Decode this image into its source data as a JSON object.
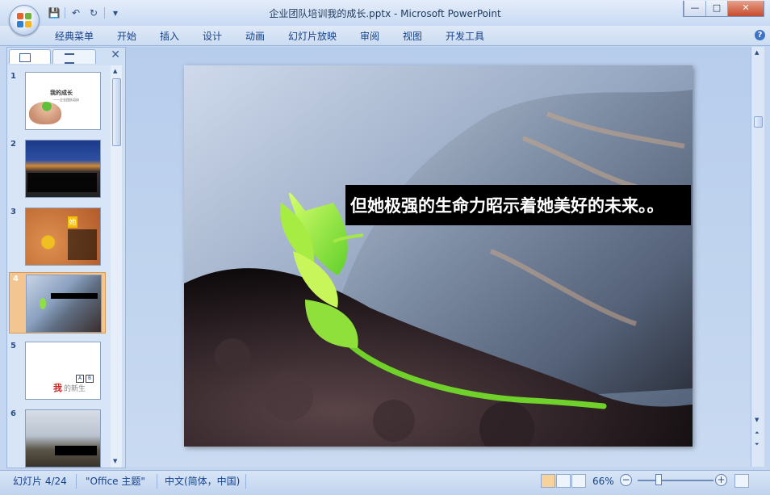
{
  "window": {
    "title": "企业团队培训我的成长.pptx - Microsoft PowerPoint",
    "controls": {
      "minimize": "—",
      "maximize": "□",
      "close": "✕"
    }
  },
  "qat": {
    "save": "💾",
    "undo": "↶",
    "redo": "↻",
    "more": "▾"
  },
  "menu": [
    "经典菜单",
    "开始",
    "插入",
    "设计",
    "动画",
    "幻灯片放映",
    "审阅",
    "视图",
    "开发工具"
  ],
  "help": "?",
  "panel": {
    "close": "✕"
  },
  "thumbnails": [
    {
      "num": "1",
      "title": "我的成长",
      "subtitle": "——企业团队培训"
    },
    {
      "num": "2"
    },
    {
      "num": "3",
      "badge": "她"
    },
    {
      "num": "4"
    },
    {
      "num": "5",
      "title_red": "我",
      "title_rest": "的新生",
      "boxes": [
        "A",
        "B"
      ]
    },
    {
      "num": "6"
    }
  ],
  "slide": {
    "caption": "但她极强的生命力昭示着她美好的未来。。"
  },
  "status": {
    "slide": "幻灯片 4/24",
    "theme": "\"Office 主题\"",
    "language": "中文(简体，中国)",
    "zoom": "66%",
    "zoom_level": 0.66
  },
  "colors": {
    "accent_close": "#c74b2d",
    "selected_thumb": "#f3c590"
  }
}
